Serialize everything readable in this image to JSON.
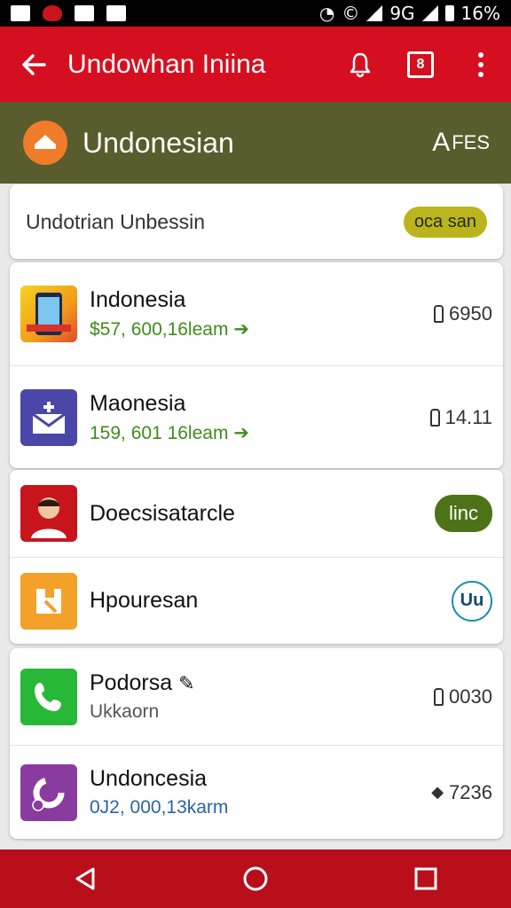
{
  "status": {
    "battery": "16%",
    "net_label": "9G"
  },
  "appbar": {
    "title": "Undowhan Iniina",
    "calendar_label": "8"
  },
  "region": {
    "name": "Undonesian",
    "lang_prefix": "A",
    "lang_code": "FES"
  },
  "search": {
    "query": "Undotrian Unbessin",
    "badge": "oca san",
    "badge_color": "#bcb41c"
  },
  "cards": [
    {
      "rows": [
        {
          "name": "Indonesia",
          "sub": "$57, 600,16leam ➔",
          "meta": "6950"
        },
        {
          "name": "Maonesia",
          "sub": "159, 601 16leam ➔",
          "meta": "14.11"
        }
      ]
    },
    {
      "rows": [
        {
          "name": "Doecsisatarcle",
          "action": "linc"
        },
        {
          "name": "Hpouresan",
          "action": "Uu"
        }
      ]
    },
    {
      "rows": [
        {
          "name": "Podorsa",
          "sub": "Ukkaorn",
          "meta": "0030"
        },
        {
          "name": "Undoncesia",
          "sub": "0J2, 000,13karm",
          "meta": "7236"
        }
      ]
    }
  ],
  "colors": {
    "appbar": "#d50f1f",
    "region": "#595c2c",
    "navbar": "#b80f1a",
    "accent_green": "#4e7217"
  }
}
